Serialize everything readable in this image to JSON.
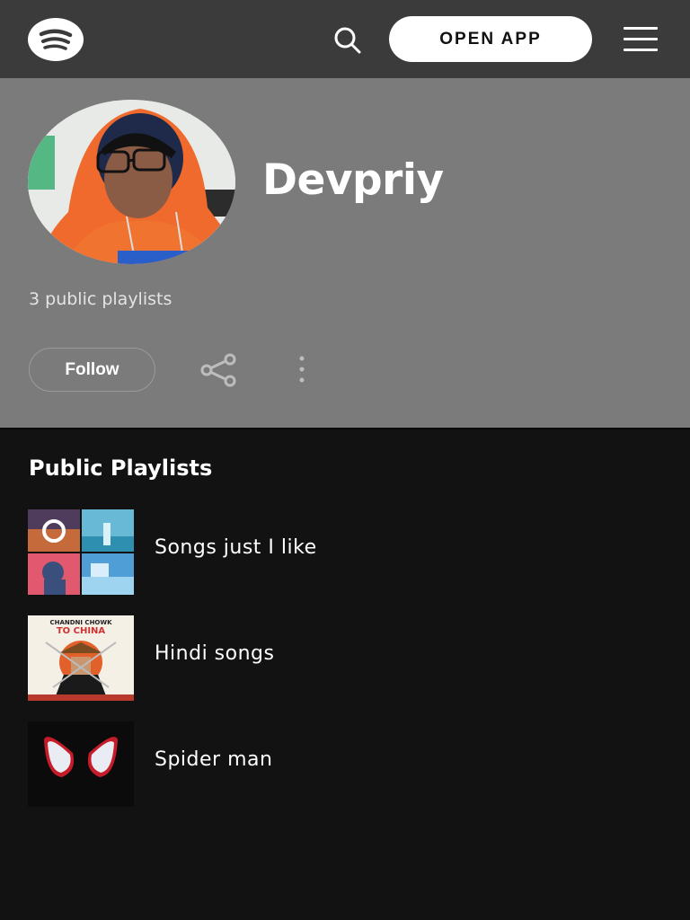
{
  "header": {
    "open_app_label": "OPEN APP",
    "icons": [
      "spotify-logo-icon",
      "search-icon",
      "hamburger-menu-icon"
    ]
  },
  "profile": {
    "name": "Devpriy",
    "meta": "3 public playlists",
    "follow_label": "Follow",
    "icons": [
      "share-icon",
      "more-options-icon"
    ]
  },
  "playlists": {
    "title": "Public Playlists",
    "items": [
      {
        "label": "Songs just I like"
      },
      {
        "label": "Hindi songs",
        "cover_text": [
          "CHANDNI CHOWK",
          "TO CHINA"
        ]
      },
      {
        "label": "Spider man"
      }
    ]
  },
  "colors": {
    "topbar": "#3b3b3b",
    "hero": "#7b7b7b",
    "background": "#121212",
    "text": "#ffffff"
  }
}
